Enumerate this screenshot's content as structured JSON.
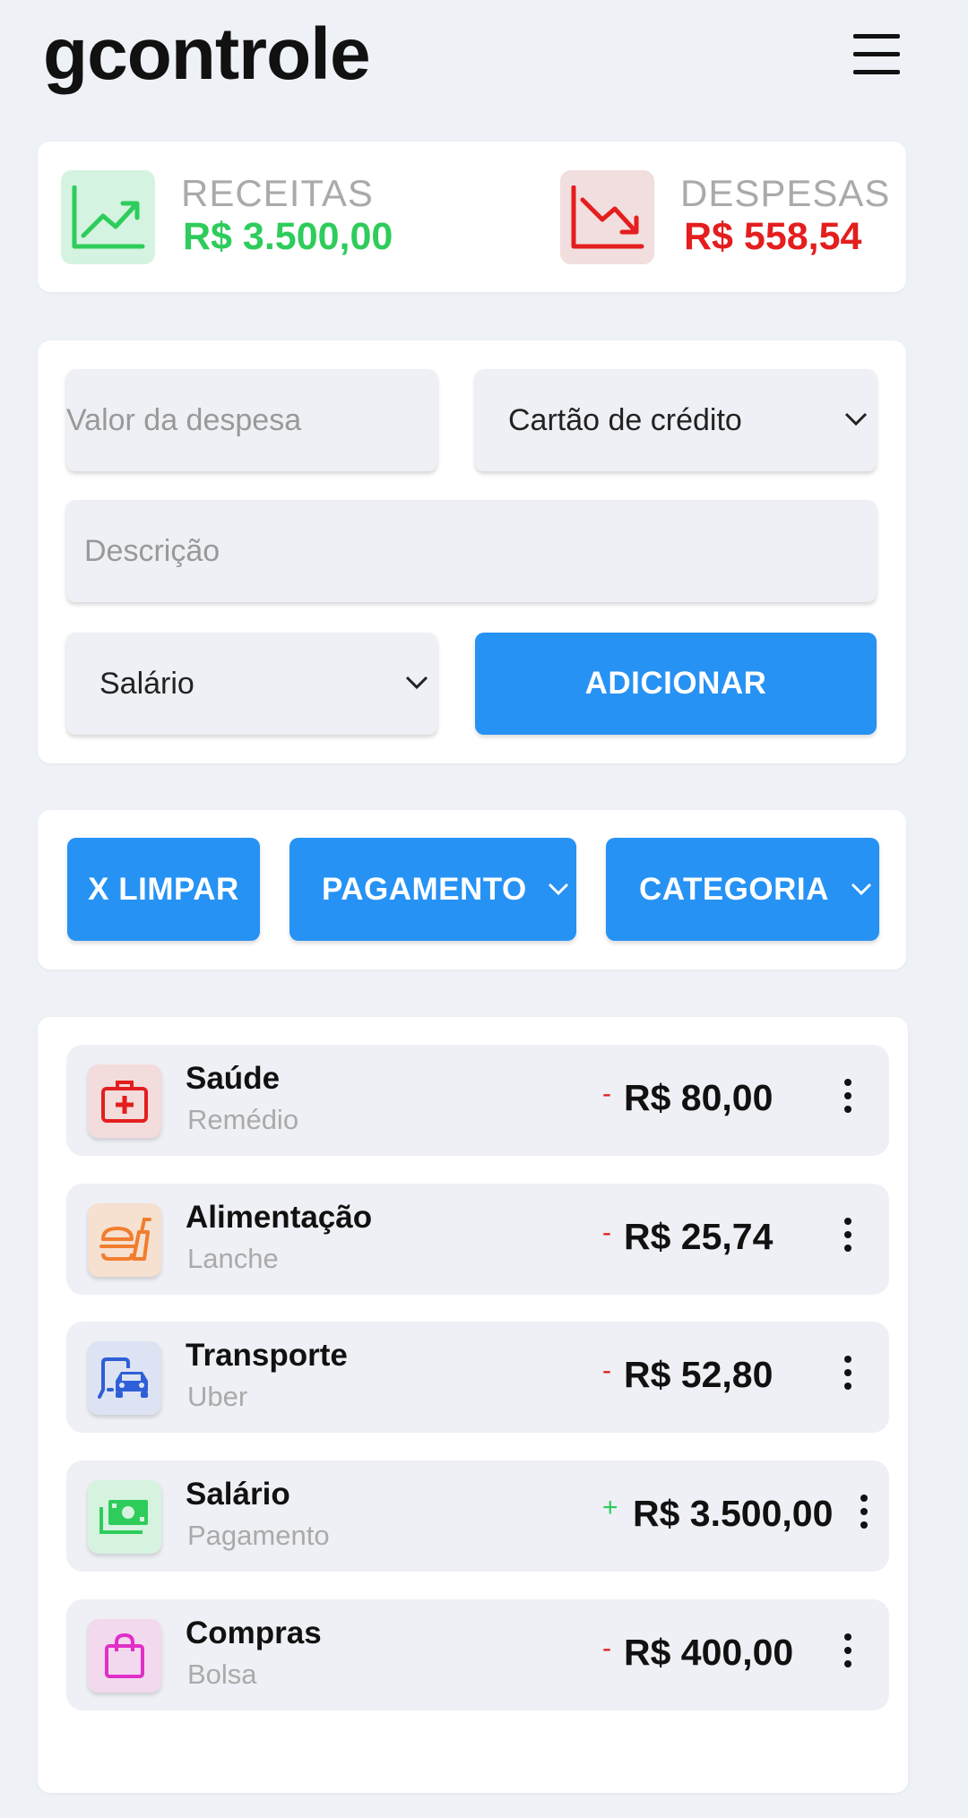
{
  "app": {
    "title": "gcontrole"
  },
  "summary": {
    "income_label": "RECEITAS",
    "income_value": "R$ 3.500,00",
    "expense_label": "DESPESAS",
    "expense_value": "R$ 558,54",
    "income_color": "#2ecc5b",
    "expense_color": "#e41e1e"
  },
  "form": {
    "value_placeholder": "Valor da despesa",
    "payment_selected": "Cartão de crédito",
    "description_placeholder": "Descrição",
    "category_selected": "Salário",
    "add_label": "ADICIONAR"
  },
  "filters": {
    "clear_label": "X LIMPAR",
    "payment_label": "PAGAMENTO",
    "category_label": "CATEGORIA"
  },
  "transactions": [
    {
      "category": "Saúde",
      "description": "Remédio",
      "sign": "-",
      "amount": "R$ 80,00",
      "icon": "medical-kit-icon"
    },
    {
      "category": "Alimentação",
      "description": "Lanche",
      "sign": "-",
      "amount": "R$ 25,74",
      "icon": "fast-food-icon"
    },
    {
      "category": "Transporte",
      "description": "Uber",
      "sign": "-",
      "amount": "R$ 52,80",
      "icon": "transport-icon"
    },
    {
      "category": "Salário",
      "description": "Pagamento",
      "sign": "+",
      "amount": "R$ 3.500,00",
      "icon": "money-icon"
    },
    {
      "category": "Compras",
      "description": "Bolsa",
      "sign": "-",
      "amount": "R$ 400,00",
      "icon": "shopping-bag-icon"
    }
  ],
  "colors": {
    "primary": "#2692f4",
    "background": "#eef1f6",
    "negative": "#e41e1e",
    "positive": "#2ecc5b"
  }
}
